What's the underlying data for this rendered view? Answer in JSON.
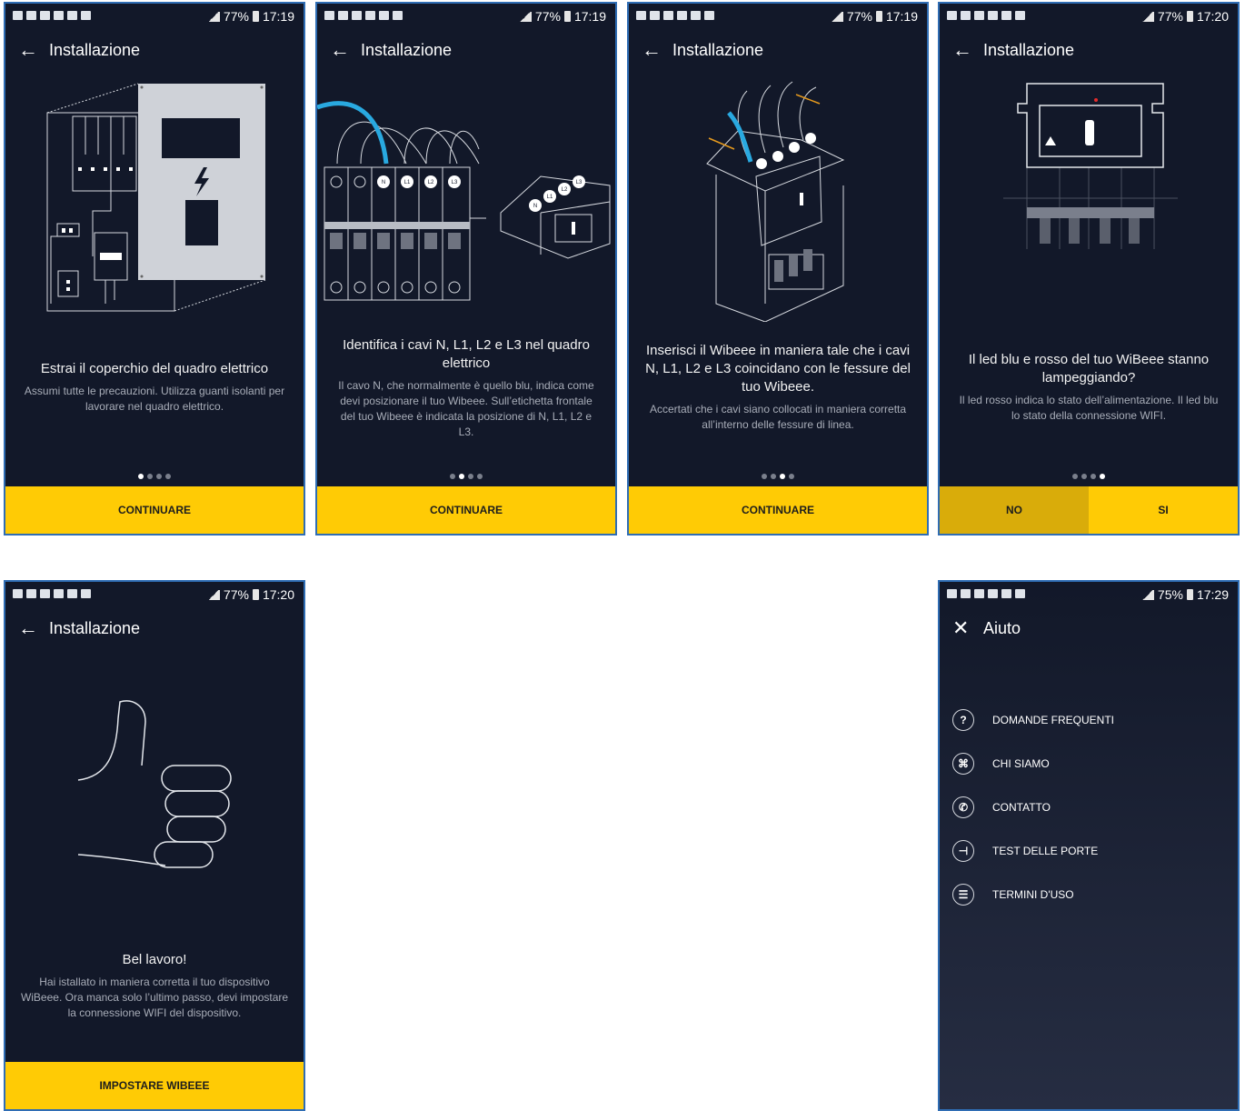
{
  "screens": [
    {
      "status": {
        "battery": "77%",
        "time": "17:19"
      },
      "title": "Installazione",
      "main": "Estrai il coperchio del quadro elettrico",
      "sub": "Assumi tutte le precauzioni. Utilizza guanti isolanti per lavorare nel quadro elettrico.",
      "cta": "CONTINUARE",
      "page_index": 1,
      "page_count": 4
    },
    {
      "status": {
        "battery": "77%",
        "time": "17:19"
      },
      "title": "Installazione",
      "main": "Identifica i cavi N, L1, L2 e L3 nel quadro elettrico",
      "sub": "Il cavo N, che normalmente è quello blu, indica come devi posizionare il tuo Wibeee. Sull’etichetta frontale del tuo Wibeee è indicata la posizione di N, L1, L2 e L3.",
      "labels": [
        "N",
        "L1",
        "L2",
        "L3"
      ],
      "cta": "CONTINUARE",
      "page_index": 2,
      "page_count": 4
    },
    {
      "status": {
        "battery": "77%",
        "time": "17:19"
      },
      "title": "Installazione",
      "main": "Inserisci il Wibeee in maniera tale che i cavi N, L1, L2 e L3 coincidano con le fessure del tuo Wibeee.",
      "sub": "Accertati che i cavi siano collocati in maniera corretta all’interno delle fessure di linea.",
      "cta": "CONTINUARE",
      "page_index": 3,
      "page_count": 4
    },
    {
      "status": {
        "battery": "77%",
        "time": "17:20"
      },
      "title": "Installazione",
      "main": "Il led blu e rosso del tuo WiBeee stanno lampeggiando?",
      "sub": "Il led rosso indica lo stato dell’alimentazione. Il led blu lo stato della connessione WIFI.",
      "no": "NO",
      "si": "SI",
      "page_index": 4,
      "page_count": 4
    },
    {
      "status": {
        "battery": "77%",
        "time": "17:20"
      },
      "title": "Installazione",
      "main": "Bel lavoro!",
      "sub": "Hai istallato in maniera corretta il tuo dispositivo WiBeee. Ora manca solo l’ultimo passo, devi impostare la connessione WIFI del dispositivo.",
      "cta": "IMPOSTARE WIBEEE"
    }
  ],
  "help": {
    "status": {
      "battery": "75%",
      "time": "17:29"
    },
    "title": "Aiuto",
    "items": [
      {
        "icon": "question-icon",
        "label": "DOMANDE FREQUENTI"
      },
      {
        "icon": "wibeee-logo-icon",
        "label": "CHI SIAMO"
      },
      {
        "icon": "phone-icon",
        "label": "CONTATTO"
      },
      {
        "icon": "network-icon",
        "label": "TEST DELLE PORTE"
      },
      {
        "icon": "document-icon",
        "label": "TERMINI D'USO"
      }
    ]
  },
  "colors": {
    "background": "#121829",
    "accent": "#ffcb05",
    "frame": "#2f6db4",
    "cable_blue": "#29a9e0",
    "led_red": "#e32b2b"
  }
}
